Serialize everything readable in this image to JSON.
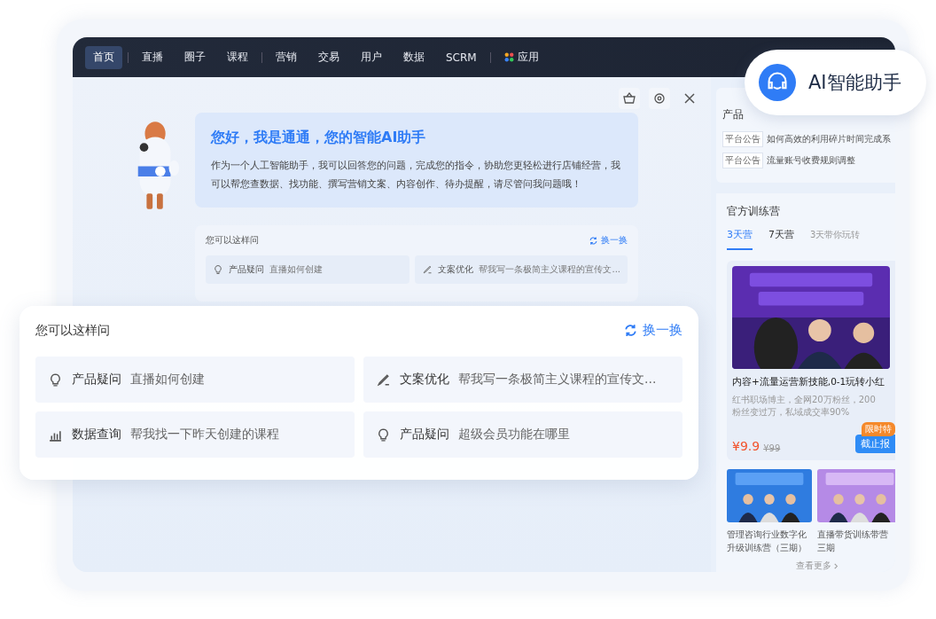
{
  "nav": {
    "groups": [
      [
        {
          "label": "首页",
          "selected": true,
          "kind": "text"
        }
      ],
      [
        {
          "label": "直播",
          "selected": false,
          "kind": "text"
        },
        {
          "label": "圈子",
          "selected": false,
          "kind": "text"
        },
        {
          "label": "课程",
          "selected": false,
          "kind": "text"
        }
      ],
      [
        {
          "label": "营销",
          "selected": false,
          "kind": "text"
        },
        {
          "label": "交易",
          "selected": false,
          "kind": "text"
        },
        {
          "label": "用户",
          "selected": false,
          "kind": "text"
        },
        {
          "label": "数据",
          "selected": false,
          "kind": "text"
        },
        {
          "label": "SCRM",
          "selected": false,
          "kind": "text"
        }
      ],
      [
        {
          "label": "应用",
          "selected": false,
          "kind": "apps"
        }
      ]
    ]
  },
  "assistant": {
    "greeting": "您好，我是通通，您的智能AI助手",
    "intro": "作为一个人工智能助手，我可以回答您的问题，完成您的指令，协助您更轻松进行店铺经营，我可以帮您查数据、找功能、撰写营销文案、内容创作、待办提醒，请尽管问我问题哦！",
    "suggestions": {
      "title": "您可以这样问",
      "refresh": "换一换",
      "items": [
        {
          "kind": "bulb",
          "category": "产品疑问",
          "text": "直播如何创建"
        },
        {
          "kind": "pen",
          "category": "文案优化",
          "text": "帮我写一条极简主义课程的宣传文..."
        }
      ]
    }
  },
  "popup": {
    "title": "您可以这样问",
    "refresh": "换一换",
    "items": [
      {
        "kind": "bulb",
        "category": "产品疑问",
        "text": "直播如何创建"
      },
      {
        "kind": "pen",
        "category": "文案优化",
        "text": "帮我写一条极简主义课程的宣传文..."
      },
      {
        "kind": "chart",
        "category": "数据查询",
        "text": "帮我找一下昨天创建的课程"
      },
      {
        "kind": "bulb",
        "category": "产品疑问",
        "text": "超级会员功能在哪里"
      }
    ]
  },
  "badge": {
    "label": "AI智能助手"
  },
  "sidebar": {
    "news_title": "产品",
    "news": [
      {
        "tag": "平台公告",
        "text": "如何高效的利用碎片时间完成系"
      },
      {
        "tag": "平台公告",
        "text": "流量账号收费规则调整"
      }
    ],
    "camp_title": "官方训练营",
    "tabs": [
      {
        "label": "3天营",
        "selected": true
      },
      {
        "label": "7天营",
        "selected": false
      },
      {
        "label": "3天带你玩转",
        "selected": false
      }
    ],
    "featured": {
      "kind": "picture",
      "title": "内容+流量运营新技能,0-1玩转小红",
      "desc": "红书职场博主，全网20万粉丝，200粉丝变过万，私域成交率90%",
      "price": "¥9.9",
      "old_price": "¥99",
      "promo": "限时特",
      "cta": "截止报"
    },
    "courses": [
      {
        "kind": "picture",
        "title": "管理咨询行业数字化升级训练营（三期）"
      },
      {
        "kind": "picture",
        "title": "直播带货训练带营三期"
      }
    ],
    "more": "查看更多"
  }
}
